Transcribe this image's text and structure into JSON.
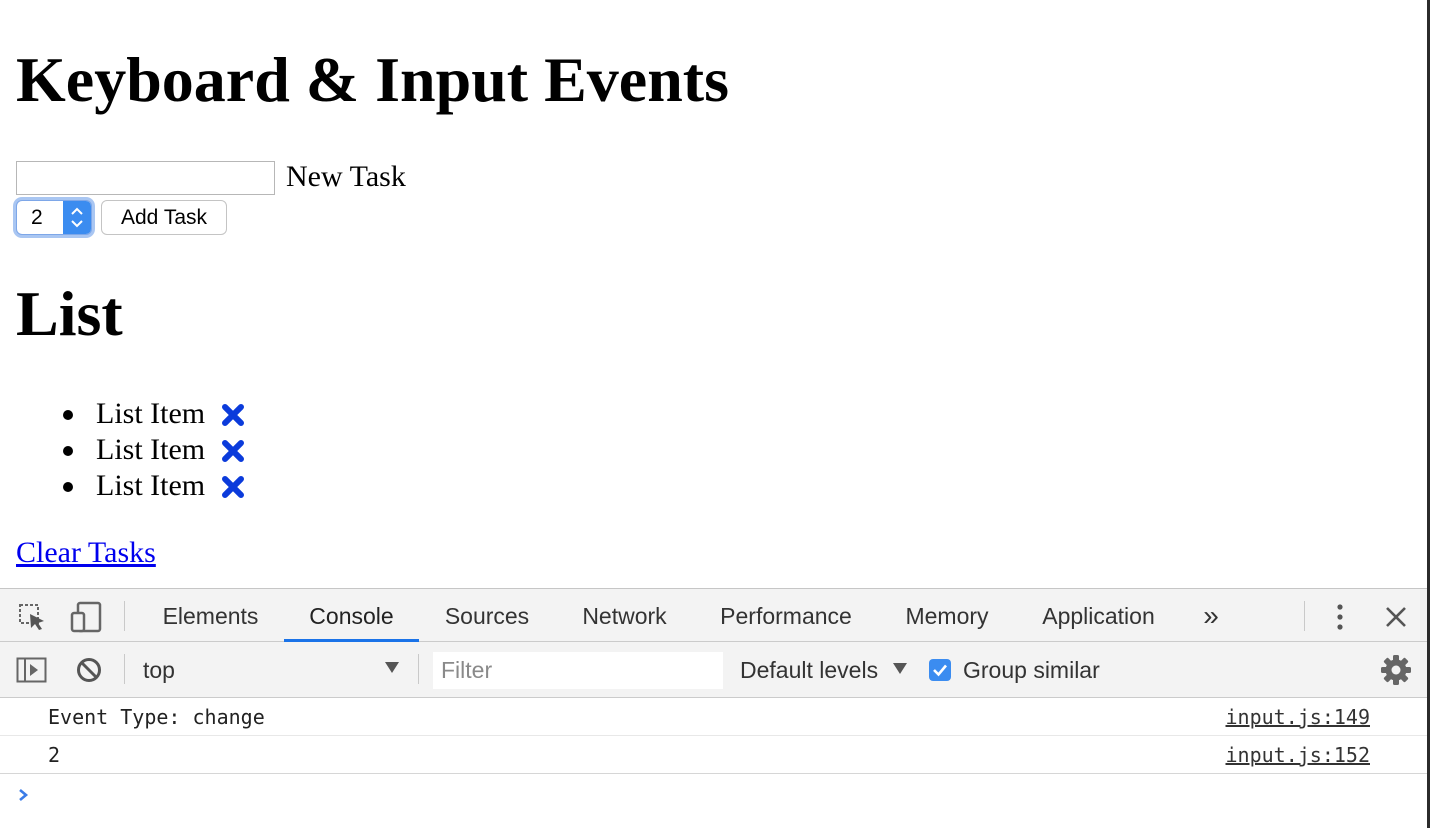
{
  "page": {
    "title": "Keyboard & Input Events",
    "task_input": {
      "value": "",
      "placeholder": ""
    },
    "task_label": "New Task",
    "priority_select": {
      "value": "2",
      "icon": "updown-chevron-icon"
    },
    "add_button": "Add Task",
    "list_title": "List",
    "items": [
      {
        "label": "List Item",
        "icon": "delete-x-icon"
      },
      {
        "label": "List Item",
        "icon": "delete-x-icon"
      },
      {
        "label": "List Item",
        "icon": "delete-x-icon"
      }
    ],
    "clear_link": "Clear Tasks",
    "colors": {
      "link": "#0000ee",
      "delete_icon": "#0b3bdb"
    }
  },
  "devtools": {
    "tabs": [
      "Elements",
      "Console",
      "Sources",
      "Network",
      "Performance",
      "Memory",
      "Application"
    ],
    "active_tab": "Console",
    "icons": {
      "inspect": "inspect-element-icon",
      "device": "device-toolbar-icon",
      "more_tabs": "chevron-double-right-icon",
      "menu": "kebab-menu-icon",
      "close": "close-icon",
      "sidebar": "sidebar-toggle-icon",
      "clear": "clear-console-icon",
      "settings": "gear-icon",
      "prompt": "prompt-chevron-icon"
    },
    "more_tabs_label": "»",
    "context": "top",
    "filter_placeholder": "Filter",
    "levels": "Default levels",
    "group_similar": {
      "label": "Group similar",
      "checked": true
    },
    "messages": [
      {
        "text": "Event Type: change",
        "source": "input.js:149"
      },
      {
        "text": "2",
        "source": "input.js:152"
      }
    ],
    "colors": {
      "accent": "#1a73e8",
      "checkbox": "#3b8cf0",
      "toolbar_bg": "#f3f3f3"
    }
  }
}
